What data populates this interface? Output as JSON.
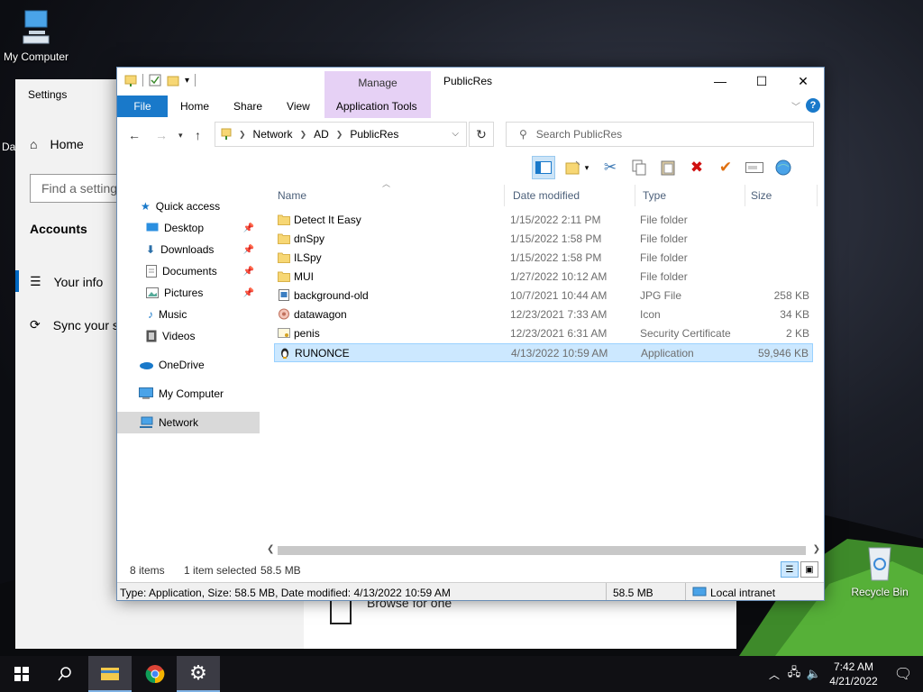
{
  "desktop": {
    "icons": [
      {
        "label": "My Computer"
      },
      {
        "label": "Recycle Bin"
      }
    ],
    "edge_label": "Da"
  },
  "settings": {
    "title": "Settings",
    "home_label": "Home",
    "search_placeholder": "Find a setting",
    "section": "Accounts",
    "items": [
      {
        "label": "Your info"
      },
      {
        "label": "Sync your s"
      }
    ],
    "browse_label": "Browse for one"
  },
  "explorer": {
    "title": "PublicRes",
    "context_tab": "Manage",
    "tabs": [
      {
        "label": "File"
      },
      {
        "label": "Home"
      },
      {
        "label": "Share"
      },
      {
        "label": "View"
      },
      {
        "label": "Application Tools"
      }
    ],
    "breadcrumb": [
      "Network",
      "AD",
      "PublicRes"
    ],
    "search_placeholder": "Search PublicRes",
    "nav": [
      {
        "label": "Quick access",
        "icon": "star-icon",
        "pinned": false
      },
      {
        "label": "Desktop",
        "icon": "desktop-icon",
        "pinned": true
      },
      {
        "label": "Downloads",
        "icon": "download-icon",
        "pinned": true
      },
      {
        "label": "Documents",
        "icon": "documents-icon",
        "pinned": true
      },
      {
        "label": "Pictures",
        "icon": "pictures-icon",
        "pinned": true
      },
      {
        "label": "Music",
        "icon": "music-icon",
        "pinned": false
      },
      {
        "label": "Videos",
        "icon": "videos-icon",
        "pinned": false
      },
      {
        "label": "OneDrive",
        "icon": "cloud-icon",
        "pinned": false
      },
      {
        "label": "My Computer",
        "icon": "computer-icon",
        "pinned": false
      },
      {
        "label": "Network",
        "icon": "network-icon",
        "pinned": false,
        "selected": true
      }
    ],
    "columns": {
      "name": "Name",
      "date": "Date modified",
      "type": "Type",
      "size": "Size"
    },
    "files": [
      {
        "name": "Detect It Easy",
        "date": "1/15/2022 2:11 PM",
        "type": "File folder",
        "size": "",
        "icon": "folder-icon"
      },
      {
        "name": "dnSpy",
        "date": "1/15/2022 1:58 PM",
        "type": "File folder",
        "size": "",
        "icon": "folder-icon"
      },
      {
        "name": "ILSpy",
        "date": "1/15/2022 1:58 PM",
        "type": "File folder",
        "size": "",
        "icon": "folder-icon"
      },
      {
        "name": "MUI",
        "date": "1/27/2022 10:12 AM",
        "type": "File folder",
        "size": "",
        "icon": "folder-icon"
      },
      {
        "name": "background-old",
        "date": "10/7/2021 10:44 AM",
        "type": "JPG File",
        "size": "258 KB",
        "icon": "image-file-icon"
      },
      {
        "name": "datawagon",
        "date": "12/23/2021 7:33 AM",
        "type": "Icon",
        "size": "34 KB",
        "icon": "icon-file-icon"
      },
      {
        "name": "penis",
        "date": "12/23/2021 6:31 AM",
        "type": "Security Certificate",
        "size": "2 KB",
        "icon": "certificate-icon"
      },
      {
        "name": "RUNONCE",
        "date": "4/13/2022 10:59 AM",
        "type": "Application",
        "size": "59,946 KB",
        "icon": "application-icon",
        "selected": true
      }
    ],
    "status": {
      "count": "8 items",
      "selected": "1 item selected",
      "selected_size": "58.5 MB"
    },
    "details": {
      "info": "Type: Application, Size: 58.5 MB, Date modified: 4/13/2022 10:59 AM",
      "size": "58.5 MB",
      "zone": "Local intranet"
    }
  },
  "taskbar": {
    "time": "7:42 AM",
    "date": "4/21/2022"
  },
  "colors": {
    "accent": "#1979ca",
    "manage_tab": "#e6d1f5",
    "selection": "#cce8ff",
    "delete_red": "#d01010",
    "check_orange": "#e07010"
  }
}
